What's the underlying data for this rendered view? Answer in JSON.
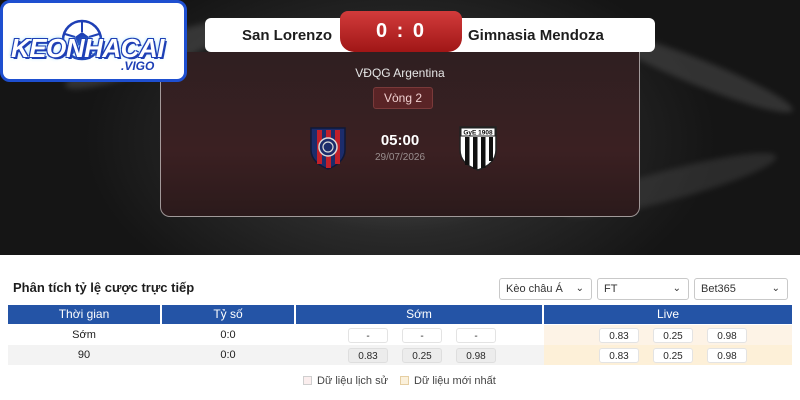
{
  "brand": {
    "logo_main": "KEONHACAI",
    "logo_sub": ".VIGO",
    "accent": "#1e4fd0"
  },
  "match": {
    "home_team": "San Lorenzo",
    "away_team": "Gimnasia Mendoza",
    "score": "0 : 0",
    "league": "VĐQG Argentina",
    "round": "Vòng 2",
    "kickoff_time": "05:00",
    "kickoff_date": "29/07/2026",
    "home_crest": "san-lorenzo-crest",
    "away_crest": "gimnasia-mendoza-crest",
    "away_crest_text": "GyE 1908",
    "score_color": "#b92323"
  },
  "odds": {
    "title": "Phân tích tỷ lệ cược trực tiếp",
    "filters": {
      "market": "Kèo châu Á",
      "period": "FT",
      "bookmaker": "Bet365"
    },
    "columns": [
      "Thời gian",
      "Tỷ số",
      "Sớm",
      "Live"
    ],
    "rows": [
      {
        "time": "Sớm",
        "score": "0:0",
        "early": [
          "-",
          "-",
          "-"
        ],
        "live": [
          "0.83",
          "0.25",
          "0.98"
        ]
      },
      {
        "time": "90",
        "score": "0:0",
        "early": [
          "0.83",
          "0.25",
          "0.98"
        ],
        "live": [
          "0.83",
          "0.25",
          "0.98"
        ]
      }
    ],
    "legend": {
      "history": "Dữ liệu lịch sử",
      "latest": "Dữ liệu mới nhất"
    },
    "header_color": "#2454a6"
  }
}
